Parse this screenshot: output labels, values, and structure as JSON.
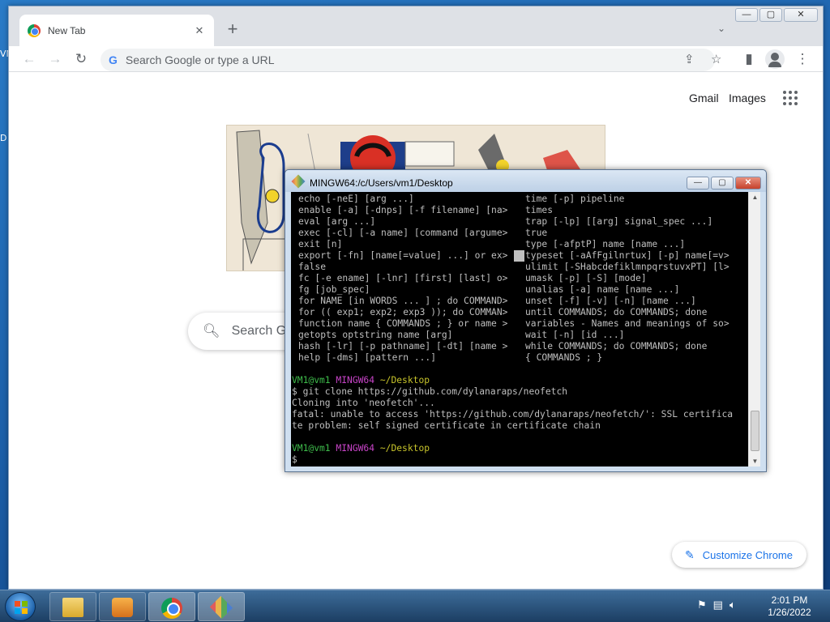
{
  "desktop": {
    "label_top": "VM",
    "label_mid": "D"
  },
  "browser": {
    "tab_title": "New Tab",
    "new_tab_symbol": "+",
    "close_symbol": "✕",
    "omnibox_placeholder": "Search Google or type a URL",
    "window_buttons": {
      "minimize": "—",
      "maximize": "▢",
      "close": "✕"
    }
  },
  "ntp": {
    "gmail": "Gmail",
    "images": "Images",
    "search_placeholder": "Search Go",
    "customize_label": "Customize Chrome"
  },
  "terminal": {
    "title": "MINGW64:/c/Users/vm1/Desktop",
    "help_left": [
      "echo [-neE] [arg ...]",
      "enable [-a] [-dnps] [-f filename] [na>",
      "eval [arg ...]",
      "exec [-cl] [-a name] [command [argume>",
      "exit [n]",
      "export [-fn] [name[=value] ...] or ex>",
      "false",
      "fc [-e ename] [-lnr] [first] [last] o>",
      "fg [job_spec]",
      "for NAME [in WORDS ... ] ; do COMMAND>",
      "for (( exp1; exp2; exp3 )); do COMMAN>",
      "function name { COMMANDS ; } or name >",
      "getopts optstring name [arg]",
      "hash [-lr] [-p pathname] [-dt] [name >",
      "help [-dms] [pattern ...]"
    ],
    "help_right": [
      "time [-p] pipeline",
      "times",
      "trap [-lp] [[arg] signal_spec ...]",
      "true",
      "type [-afptP] name [name ...]",
      "typeset [-aAfFgilnrtux] [-p] name[=v>",
      "ulimit [-SHabcdefiklmnpqrstuvxPT] [l>",
      "umask [-p] [-S] [mode]",
      "unalias [-a] name [name ...]",
      "unset [-f] [-v] [-n] [name ...]",
      "until COMMANDS; do COMMANDS; done",
      "variables - Names and meanings of so>",
      "wait [-n] [id ...]",
      "while COMMANDS; do COMMANDS; done",
      "{ COMMANDS ; }"
    ],
    "prompt_user": "VM1@vm1",
    "prompt_env": "MINGW64",
    "prompt_dir": "~/Desktop",
    "cmd_line": "$ git clone https://github.com/dylanaraps/neofetch",
    "out1": "Cloning into 'neofetch'...",
    "out2": "fatal: unable to access 'https://github.com/dylanaraps/neofetch/': SSL certifica",
    "out3": "te problem: self signed certificate in certificate chain",
    "prompt_symbol": "$"
  },
  "taskbar": {
    "clock_time": "2:01 PM",
    "clock_date": "1/26/2022"
  }
}
